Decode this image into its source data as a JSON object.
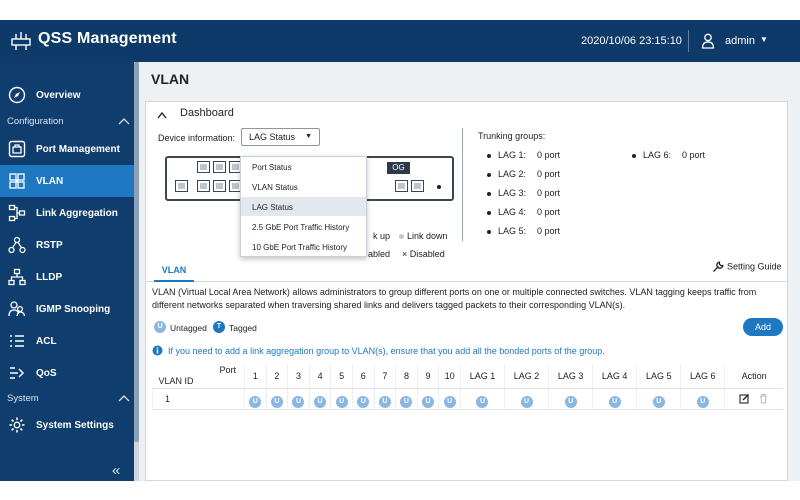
{
  "header": {
    "title": "QSS Management",
    "datetime": "2020/10/06  23:15:10",
    "user": "admin"
  },
  "sidebar": {
    "overview": "Overview",
    "configuration_section": "Configuration",
    "items": [
      {
        "label": "Port Management",
        "icon": "port-icon"
      },
      {
        "label": "VLAN",
        "icon": "vlan-icon",
        "active": true
      },
      {
        "label": "Link Aggregation",
        "icon": "link-aggregation-icon"
      },
      {
        "label": "RSTP",
        "icon": "rstp-icon"
      },
      {
        "label": "LLDP",
        "icon": "lldp-icon"
      },
      {
        "label": "IGMP Snooping",
        "icon": "igmp-icon"
      },
      {
        "label": "ACL",
        "icon": "acl-icon"
      },
      {
        "label": "QoS",
        "icon": "qos-icon"
      }
    ],
    "system_section": "System",
    "system_settings": "System Settings",
    "collapse": "«"
  },
  "page": {
    "title": "VLAN"
  },
  "dashboard": {
    "title": "Dashboard",
    "device_info_label": "Device information:",
    "selected_option": "LAG Status",
    "options": [
      "Port Status",
      "VLAN Status",
      "LAG Status",
      "2.5 GbE Port Traffic History",
      "10 GbE Port Traffic History"
    ],
    "lag_badge": "OG",
    "legend": {
      "link_up_fragment": "k up",
      "link_down": "Link down",
      "disabled_fragment": "abled",
      "disabled": "Disabled",
      "disabled_symbol": "×"
    },
    "trunking_title": "Trunking groups:",
    "lag_groups": [
      {
        "name": "LAG 1:",
        "value": "0 port"
      },
      {
        "name": "LAG 2:",
        "value": "0 port"
      },
      {
        "name": "LAG 3:",
        "value": "0 port"
      },
      {
        "name": "LAG 4:",
        "value": "0 port"
      },
      {
        "name": "LAG 5:",
        "value": "0 port"
      },
      {
        "name": "LAG 6:",
        "value": "0 port"
      }
    ]
  },
  "vlan": {
    "tab_label": "VLAN",
    "setting_guide": "Setting Guide",
    "description": "VLAN (Virtual Local Area Network) allows administrators to group different ports on one or multiple connected switches. VLAN tagging keeps traffic from different networks separated when traversing shared links and delivers tagged packets to their corresponding VLAN(s).",
    "untagged_badge": "U",
    "untagged_label": "Untagged",
    "tagged_badge": "T",
    "tagged_label": "Tagged",
    "add_button": "Add",
    "info_text": "If you need to add a link aggregation group to VLAN(s), ensure that you add all the bonded ports of the group.",
    "table": {
      "corner_port": "Port",
      "corner_vlan_id": "VLAN ID",
      "columns": [
        "1",
        "2",
        "3",
        "4",
        "5",
        "6",
        "7",
        "8",
        "9",
        "10",
        "LAG 1",
        "LAG 2",
        "LAG 3",
        "LAG 4",
        "LAG 5",
        "LAG 6"
      ],
      "action_header": "Action",
      "rows": [
        {
          "vlan_id": "1",
          "cells": [
            "U",
            "U",
            "U",
            "U",
            "U",
            "U",
            "U",
            "U",
            "U",
            "U",
            "U",
            "U",
            "U",
            "U",
            "U",
            "U"
          ]
        }
      ]
    }
  },
  "colors": {
    "navy": "#0f3d6e",
    "accent_blue": "#1d78c1",
    "untagged_badge": "#8ab6e2"
  }
}
